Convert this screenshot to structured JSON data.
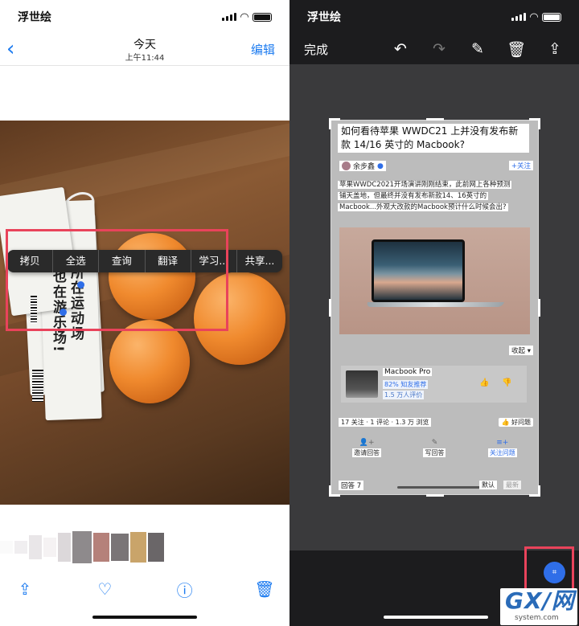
{
  "left": {
    "status": {
      "app": "浮世绘"
    },
    "nav": {
      "back": "‹",
      "title": "今天",
      "subtitle": "上午11:44",
      "edit": "编辑"
    },
    "menu": [
      "拷贝",
      "全选",
      "查询",
      "翻译",
      "学习...",
      "共享..."
    ],
    "toolbar": {
      "share": "share-icon",
      "like": "heart-icon",
      "info": "info-icon",
      "delete": "trash-icon"
    }
  },
  "right": {
    "status": {
      "app": "浮世绘"
    },
    "toolbar": {
      "done": "完成"
    },
    "doc": {
      "title": "如何看待苹果 WWDC21 上并没有发布新款 14/16 英寸的 Macbook?",
      "author": "余步鑫",
      "follow": "+关注",
      "para": [
        "苹果WWDC2021开场演讲刚刚结束，此前网上各种预测",
        "铺天盖地，但最终并没有发布新款14、16英寸的",
        "Macbook...外观大改款的Macbook预计什么时候会出?"
      ],
      "collapse": "收起 ▾",
      "product": {
        "name": "Macbook Pro",
        "recommend": "82% 知友推荐",
        "reviews": "1.5 万人评价"
      },
      "stats": "17 关注 · 1 评论 · 1.3 万 浏览",
      "good_question": "👍 好问题",
      "actions": [
        {
          "icon": "👤+",
          "label": "邀请回答"
        },
        {
          "icon": "✎",
          "label": "写回答"
        },
        {
          "icon": "≡+",
          "label": "关注问题"
        }
      ],
      "answers": "回答 7",
      "sort_default": "默认",
      "sort_new": "最新"
    }
  },
  "watermark": {
    "logo": "GX/网",
    "domain": "system.com"
  }
}
